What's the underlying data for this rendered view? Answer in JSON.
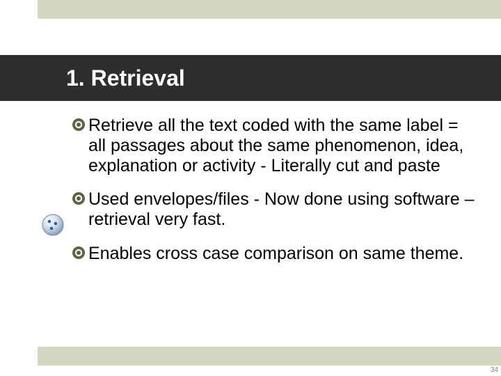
{
  "colors": {
    "accent": "#d6d7c1",
    "titleBand": "#2e2e2e",
    "bulletFill": "#5f6241"
  },
  "title": "1. Retrieval",
  "bullets": [
    "Retrieve all the text coded with the same label = all passages about the same phenomenon, idea, explanation or activity - Literally cut and paste",
    "Used envelopes/files - Now done using software – retrieval very fast.",
    "Enables cross case comparison on same theme."
  ],
  "sideIcon": "sphere-dots-icon",
  "pageNumber": "34"
}
